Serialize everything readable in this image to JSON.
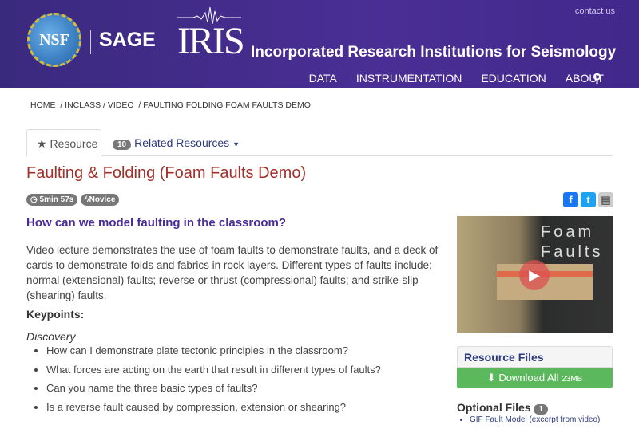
{
  "header": {
    "nsf_logo": "NSF",
    "sage": "SAGE",
    "iris": "IRIS",
    "org": "Incorporated Research Institutions for Seismology",
    "contact": "contact us",
    "nav": [
      "DATA",
      "INSTRUMENTATION",
      "EDUCATION",
      "ABOUT"
    ]
  },
  "breadcrumb": [
    "HOME",
    "INCLASS",
    "VIDEO",
    "FAULTING FOLDING FOAM FAULTS DEMO"
  ],
  "tabs": {
    "resource": "Resource",
    "related_count": "10",
    "related": "Related Resources"
  },
  "title": "Faulting & Folding (Foam Faults Demo)",
  "pills": {
    "duration": "5min 57s",
    "level": "Novice"
  },
  "question": "How can we model faulting in the classroom?",
  "description": "Video lecture demonstrates the use of foam faults to demonstrate faults, and a deck of cards to demonstrate folds and fabrics in rock layers. Different types of faults include: normal (extensional) faults; reverse or thrust (compressional) faults; and strike-slip (shearing) faults.",
  "keypoints_label": "Keypoints:",
  "discovery_label": "Discovery",
  "discovery": [
    "How can I demonstrate plate tectonic principles in the classroom?",
    "What forces are acting on the earth that result in different types of faults?",
    "Can you name the three basic types of faults?",
    "Is a reverse fault caused by compression, extension or shearing?"
  ],
  "video": {
    "line1": "Foam",
    "line2": "Faults"
  },
  "sidebar": {
    "resource_files": "Resource Files",
    "download": "Download All",
    "download_size": "23MB",
    "optional": "Optional Files",
    "optional_count": "1",
    "optional_items": [
      "GIF Fault Model (excerpt from video)"
    ]
  }
}
